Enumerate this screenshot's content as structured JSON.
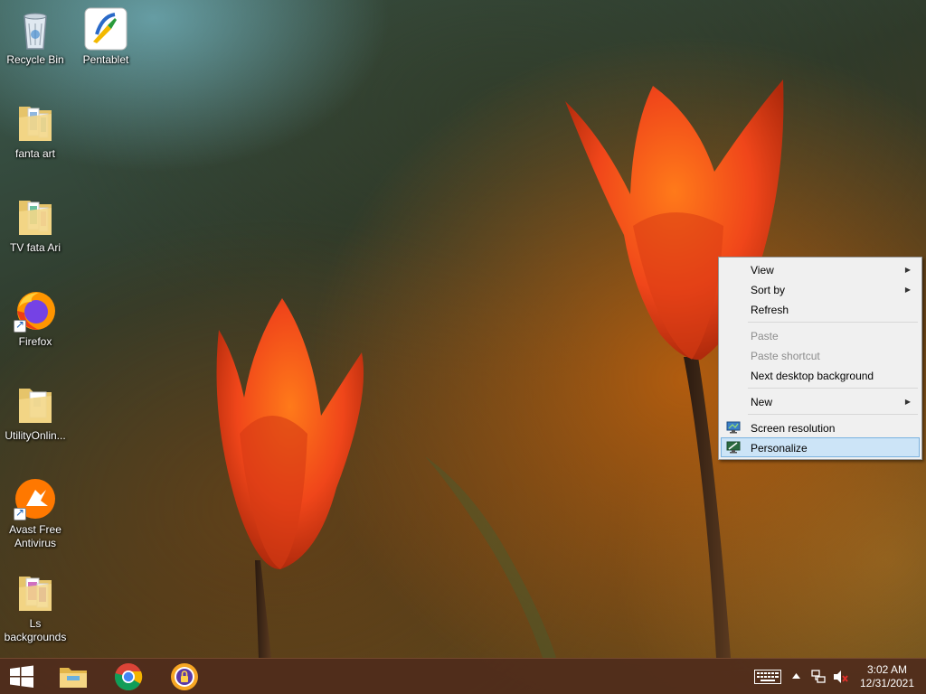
{
  "desktop": {
    "icons": [
      {
        "label": "Recycle Bin"
      },
      {
        "label": "Pentablet"
      },
      {
        "label": "fanta art"
      },
      {
        "label": "TV  fata Ari"
      },
      {
        "label": "Firefox"
      },
      {
        "label": "UtilityOnlin..."
      },
      {
        "label": "Avast Free\nAntivirus"
      },
      {
        "label": "Ls\nbackgrounds"
      }
    ]
  },
  "context_menu": {
    "items": [
      {
        "label": "View",
        "has_submenu": true
      },
      {
        "label": "Sort by",
        "has_submenu": true
      },
      {
        "label": "Refresh"
      },
      {
        "label": "Paste",
        "disabled": true
      },
      {
        "label": "Paste shortcut",
        "disabled": true
      },
      {
        "label": "Next desktop background"
      },
      {
        "label": "New",
        "has_submenu": true
      },
      {
        "label": "Screen resolution",
        "icon": "monitor-icon"
      },
      {
        "label": "Personalize",
        "icon": "monitor-icon",
        "highlighted": true
      }
    ],
    "highlight_color": "#cce4f7"
  },
  "taskbar": {
    "pinned": [
      "start-button",
      "file-explorer",
      "google-chrome",
      "vpn-shield"
    ],
    "clock": {
      "time": "3:02 AM",
      "date": "12/31/2021"
    },
    "color": "#502c1c"
  }
}
